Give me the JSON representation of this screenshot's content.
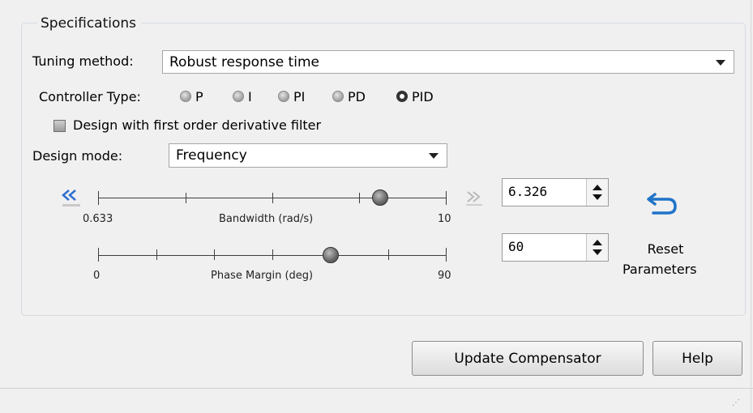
{
  "panel": {
    "title": "Specifications"
  },
  "tuning": {
    "label": "Tuning method:",
    "value": "Robust response time"
  },
  "controller": {
    "label": "Controller Type:",
    "options": [
      "P",
      "I",
      "PI",
      "PD",
      "PID"
    ],
    "selected": "PID"
  },
  "derivative_filter": {
    "label": "Design with first order derivative filter",
    "checked": false
  },
  "design_mode": {
    "label": "Design mode:",
    "value": "Frequency"
  },
  "bandwidth": {
    "min": "0.633",
    "max": "10",
    "label": "Bandwidth (rad/s)",
    "value": "6.326",
    "slider_fraction": 0.81
  },
  "phase_margin": {
    "min": "0",
    "max": "90",
    "label": "Phase Margin (deg)",
    "value": "60",
    "slider_fraction": 0.667
  },
  "reset": {
    "label_line1": "Reset",
    "label_line2": "Parameters"
  },
  "buttons": {
    "update": "Update Compensator",
    "help": "Help"
  },
  "icons": {
    "decrease": "double-chevron-left-icon",
    "increase": "double-chevron-right-icon",
    "reset": "undo-arrow-icon"
  },
  "colors": {
    "accent": "#2f6fd1",
    "reset_icon": "#1f73c8"
  }
}
